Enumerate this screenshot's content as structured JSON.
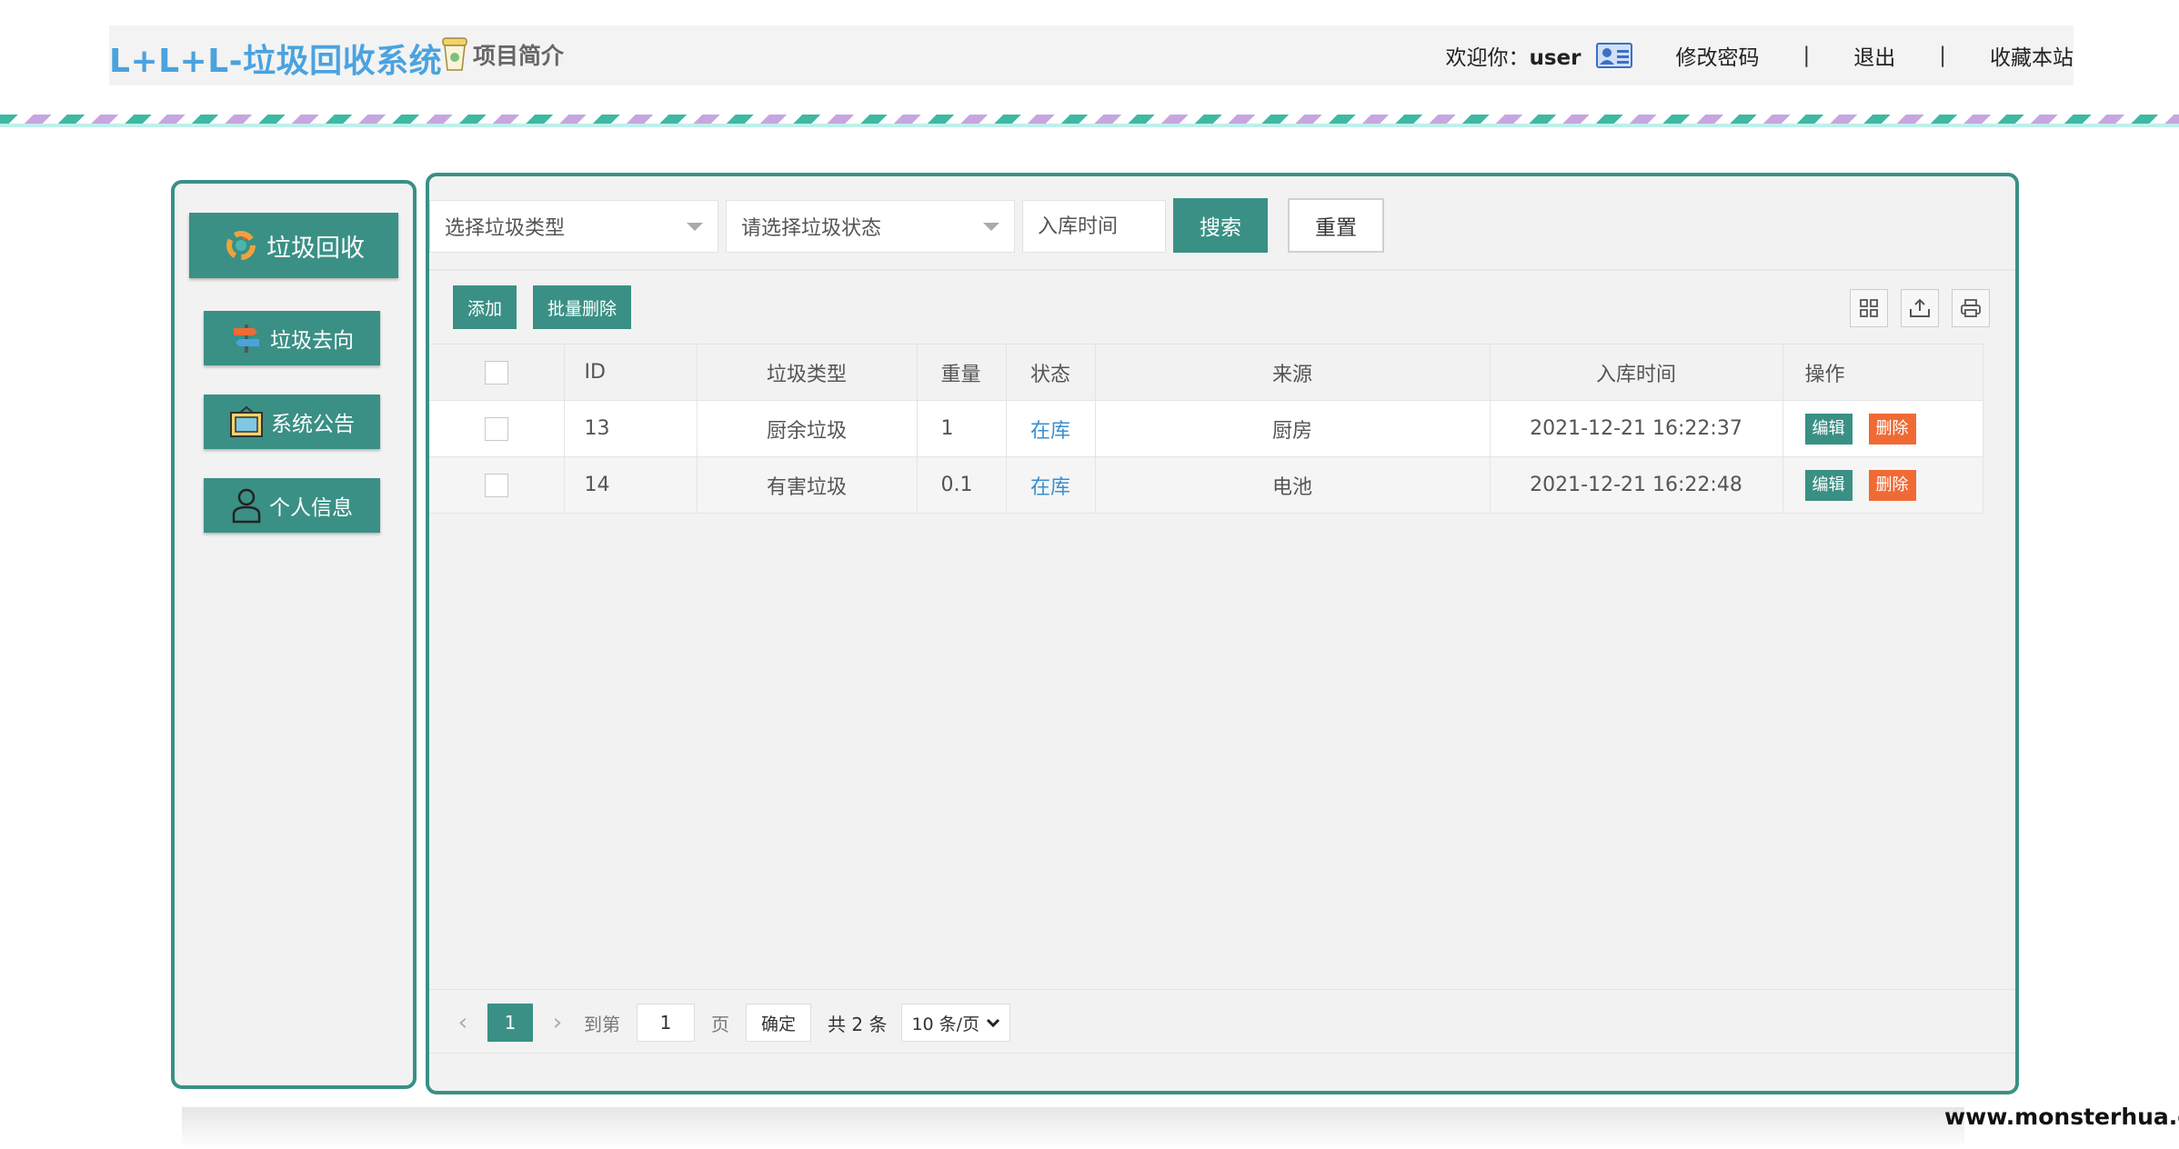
{
  "header": {
    "logo": "L+L+L-垃圾回收系统",
    "intro": "项目简介",
    "welcome_prefix": "欢迎你：",
    "username": "user",
    "change_password": "修改密码",
    "separator": "|",
    "logout": "退出",
    "bookmark": "收藏本站"
  },
  "sidebar": {
    "items": [
      {
        "label": "垃圾回收",
        "icon": "recycle-icon"
      },
      {
        "label": "垃圾去向",
        "icon": "signpost-icon"
      },
      {
        "label": "系统公告",
        "icon": "notice-board-icon"
      },
      {
        "label": "个人信息",
        "icon": "person-icon"
      }
    ]
  },
  "filters": {
    "type_placeholder": "选择垃圾类型",
    "status_placeholder": "请选择垃圾状态",
    "date_placeholder": "入库时间",
    "search": "搜索",
    "reset": "重置"
  },
  "toolbar": {
    "add": "添加",
    "batch_delete": "批量删除",
    "icons": [
      "columns-icon",
      "export-icon",
      "print-icon"
    ]
  },
  "table": {
    "headers": {
      "id": "ID",
      "type": "垃圾类型",
      "weight": "重量",
      "status": "状态",
      "source": "来源",
      "time": "入库时间",
      "ops": "操作"
    },
    "rows": [
      {
        "id": "13",
        "type": "厨余垃圾",
        "weight": "1",
        "status": "在库",
        "source": "厨房",
        "time": "2021-12-21 16:22:37",
        "edit": "编辑",
        "delete": "删除"
      },
      {
        "id": "14",
        "type": "有害垃圾",
        "weight": "0.1",
        "status": "在库",
        "source": "电池",
        "time": "2021-12-21 16:22:48",
        "edit": "编辑",
        "delete": "删除"
      }
    ]
  },
  "pager": {
    "current": "1",
    "goto": "到第",
    "input": "1",
    "page_unit": "页",
    "confirm": "确定",
    "total": "共 2 条",
    "page_size": "10 条/页"
  },
  "watermark": "www.monsterhua.com",
  "colors": {
    "primary": "#3a9085",
    "logo": "#4aa3df",
    "danger": "#f06a35",
    "link": "#3a8fd0"
  }
}
